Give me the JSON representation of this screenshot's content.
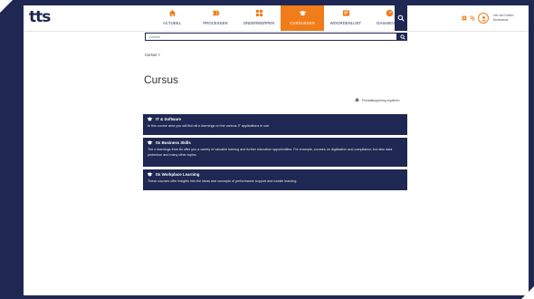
{
  "app": {
    "logo": "tts"
  },
  "nav": {
    "items": [
      {
        "label": "ACTUEEL",
        "icon": "home-icon"
      },
      {
        "label": "PROCESSEN",
        "icon": "process-icon"
      },
      {
        "label": "ONDERWERPEN",
        "icon": "grid-icon"
      },
      {
        "label": "CURSUSSEN",
        "icon": "graduation-cap-icon",
        "active": true
      },
      {
        "label": "WOORDENLIJST",
        "icon": "glossary-icon"
      },
      {
        "label": "DASHBOARD",
        "icon": "dashboard-icon"
      }
    ],
    "search_icon": "search-icon"
  },
  "user": {
    "name": "Info van Oosten",
    "company": "Nederlands"
  },
  "search": {
    "placeholder": "Zoeken"
  },
  "breadcrumb": "Cursus >",
  "page": {
    "title": "Cursus",
    "portal_link": "Portaalkoppeling kopiëren"
  },
  "courses": [
    {
      "title": "IT & Software",
      "description": "In this course area you will find all e-learnings on the various IT applications in use."
    },
    {
      "title": "tts Business Skills",
      "description": "The e-learnings from tts offer you a variety of valuable training and further education opportunities. For example, courses on digitization and compliance, but also data protection and many other topics."
    },
    {
      "title": "tts Workplace Learning",
      "description": "These courses offer insights into the ideas and concepts of performance support and mobile learning."
    }
  ],
  "colors": {
    "navy": "#1e2852",
    "accent": "#f07d1a"
  }
}
